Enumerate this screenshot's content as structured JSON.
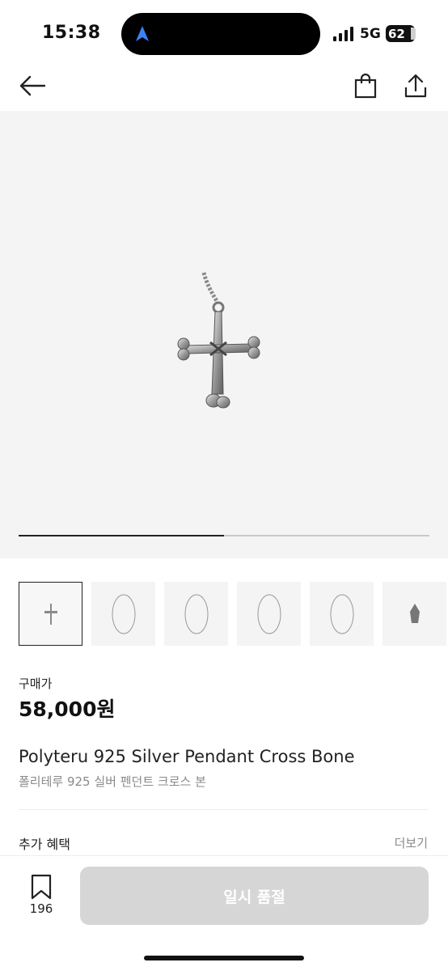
{
  "status_bar": {
    "time": "15:38",
    "network": "5G",
    "battery": "62"
  },
  "nav": {
    "back_icon": "arrow-left-icon",
    "bag_icon": "shopping-bag-icon",
    "share_icon": "share-icon"
  },
  "gallery": {
    "progress": 0.5,
    "thumbnails": [
      {
        "icon": "cross-pendant",
        "active": true
      },
      {
        "icon": "necklace-chain",
        "active": false
      },
      {
        "icon": "necklace-chain",
        "active": false
      },
      {
        "icon": "necklace-chain",
        "active": false
      },
      {
        "icon": "necklace-chain",
        "active": false
      },
      {
        "icon": "charm-pendant",
        "active": false
      }
    ]
  },
  "product": {
    "price_label": "구매가",
    "price": "58,000원",
    "title_en": "Polyteru 925 Silver Pendant Cross Bone",
    "title_ko": "폴리테루 925 실버 펜던트 크로스 본"
  },
  "benefits": {
    "label": "추가 혜택",
    "more": "더보기"
  },
  "bottom_bar": {
    "bookmark_count": "196",
    "soldout_label": "일시 품절"
  },
  "colors": {
    "background": "#ffffff",
    "hero_bg": "#f4f4f4",
    "disabled_button": "#d6d6d6",
    "text_primary": "#222222",
    "text_secondary": "#8a8a8a"
  }
}
